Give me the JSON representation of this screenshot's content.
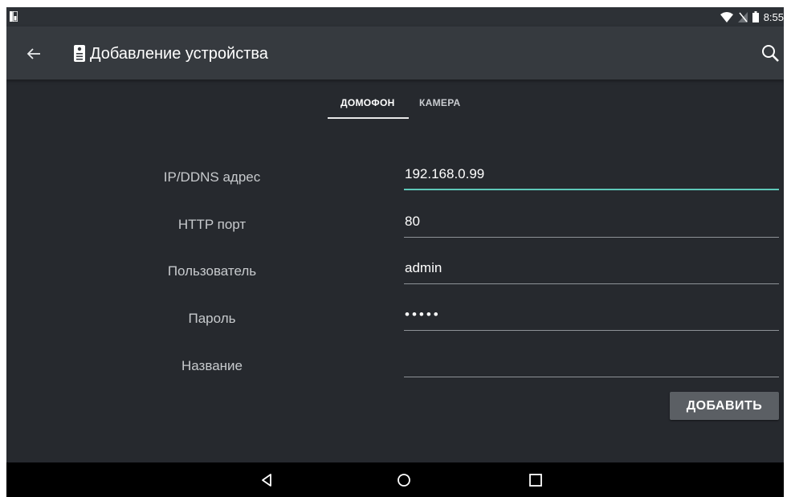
{
  "status_bar": {
    "time": "8:55",
    "icons": [
      "sim-card-icon",
      "wifi-icon",
      "no-sim-icon",
      "battery-icon"
    ]
  },
  "app_bar": {
    "title": "Добавление устройства",
    "back_icon": "arrow-left-icon",
    "app_icon": "intercom-icon",
    "search_icon": "search-icon"
  },
  "tabs": [
    {
      "label": "ДОМОФОН",
      "active": true
    },
    {
      "label": "КАМЕРА",
      "active": false
    }
  ],
  "form": {
    "fields": [
      {
        "label": "IP/DDNS адрес",
        "value": "192.168.0.99",
        "focused": true
      },
      {
        "label": "HTTP порт",
        "value": "80"
      },
      {
        "label": "Пользователь",
        "value": "admin"
      },
      {
        "label": "Пароль",
        "value": "•••••"
      },
      {
        "label": "Название",
        "value": ""
      }
    ],
    "submit_label": "ДОБАВИТЬ"
  },
  "nav_bar": {
    "icons": [
      "back-triangle-icon",
      "home-circle-icon",
      "recents-square-icon"
    ]
  },
  "colors": {
    "background": "#26292e",
    "app_bar": "#363a3f",
    "accent": "#5ec9b9",
    "button": "#5b5f64"
  }
}
